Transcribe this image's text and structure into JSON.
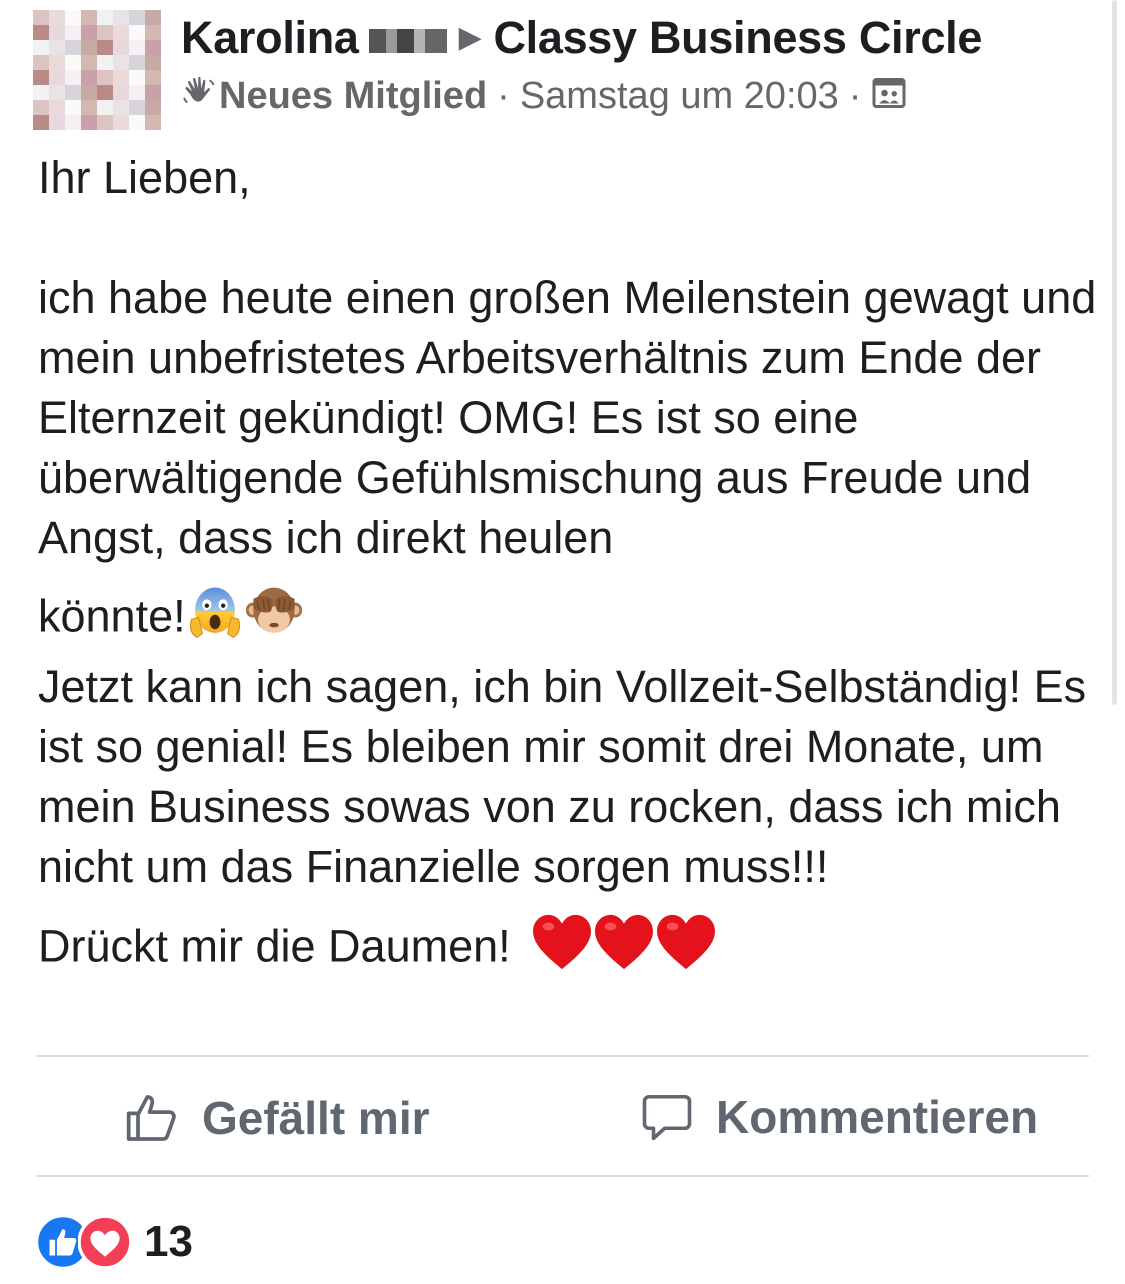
{
  "post": {
    "author": "Karolina",
    "group": "Classy Business Circle",
    "badge": "Neues Mitglied",
    "timestamp": "Samstag um 20:03",
    "body": {
      "greeting": "Ihr Lieben,",
      "paragraph_1": "ich habe heute einen großen Meilenstein gewagt und mein unbefristetes Arbeitsverhältnis zum Ende der Elternzeit gekündigt! OMG! Es ist so eine überwältigende Gefühlsmischung aus Freude und Angst, dass ich direkt heulen",
      "paragraph_1_end": "könnte!",
      "paragraph_2": "Jetzt kann ich sagen, ich bin Vollzeit-Selbständig! Es ist so genial! Es bleiben mir somit drei Monate, um mein Business sowas von zu rocken, dass ich mich nicht um das Finanzielle sorgen muss!!!",
      "closing": "Drückt mir die Daumen!"
    },
    "emojis": [
      "face-screaming-in-fear-emoji",
      "see-no-evil-monkey-emoji",
      "red-heart-emoji",
      "red-heart-emoji",
      "red-heart-emoji"
    ]
  },
  "actions": {
    "like_label": "Gefällt mir",
    "comment_label": "Kommentieren"
  },
  "reactions": {
    "count": "13",
    "types": [
      "like-reaction-icon",
      "love-reaction-icon"
    ]
  },
  "colors": {
    "text": "#1c1e21",
    "secondary": "#65676b",
    "like_blue": "#1877f2",
    "love_red": "#f33e58",
    "divider": "#dadde1"
  }
}
